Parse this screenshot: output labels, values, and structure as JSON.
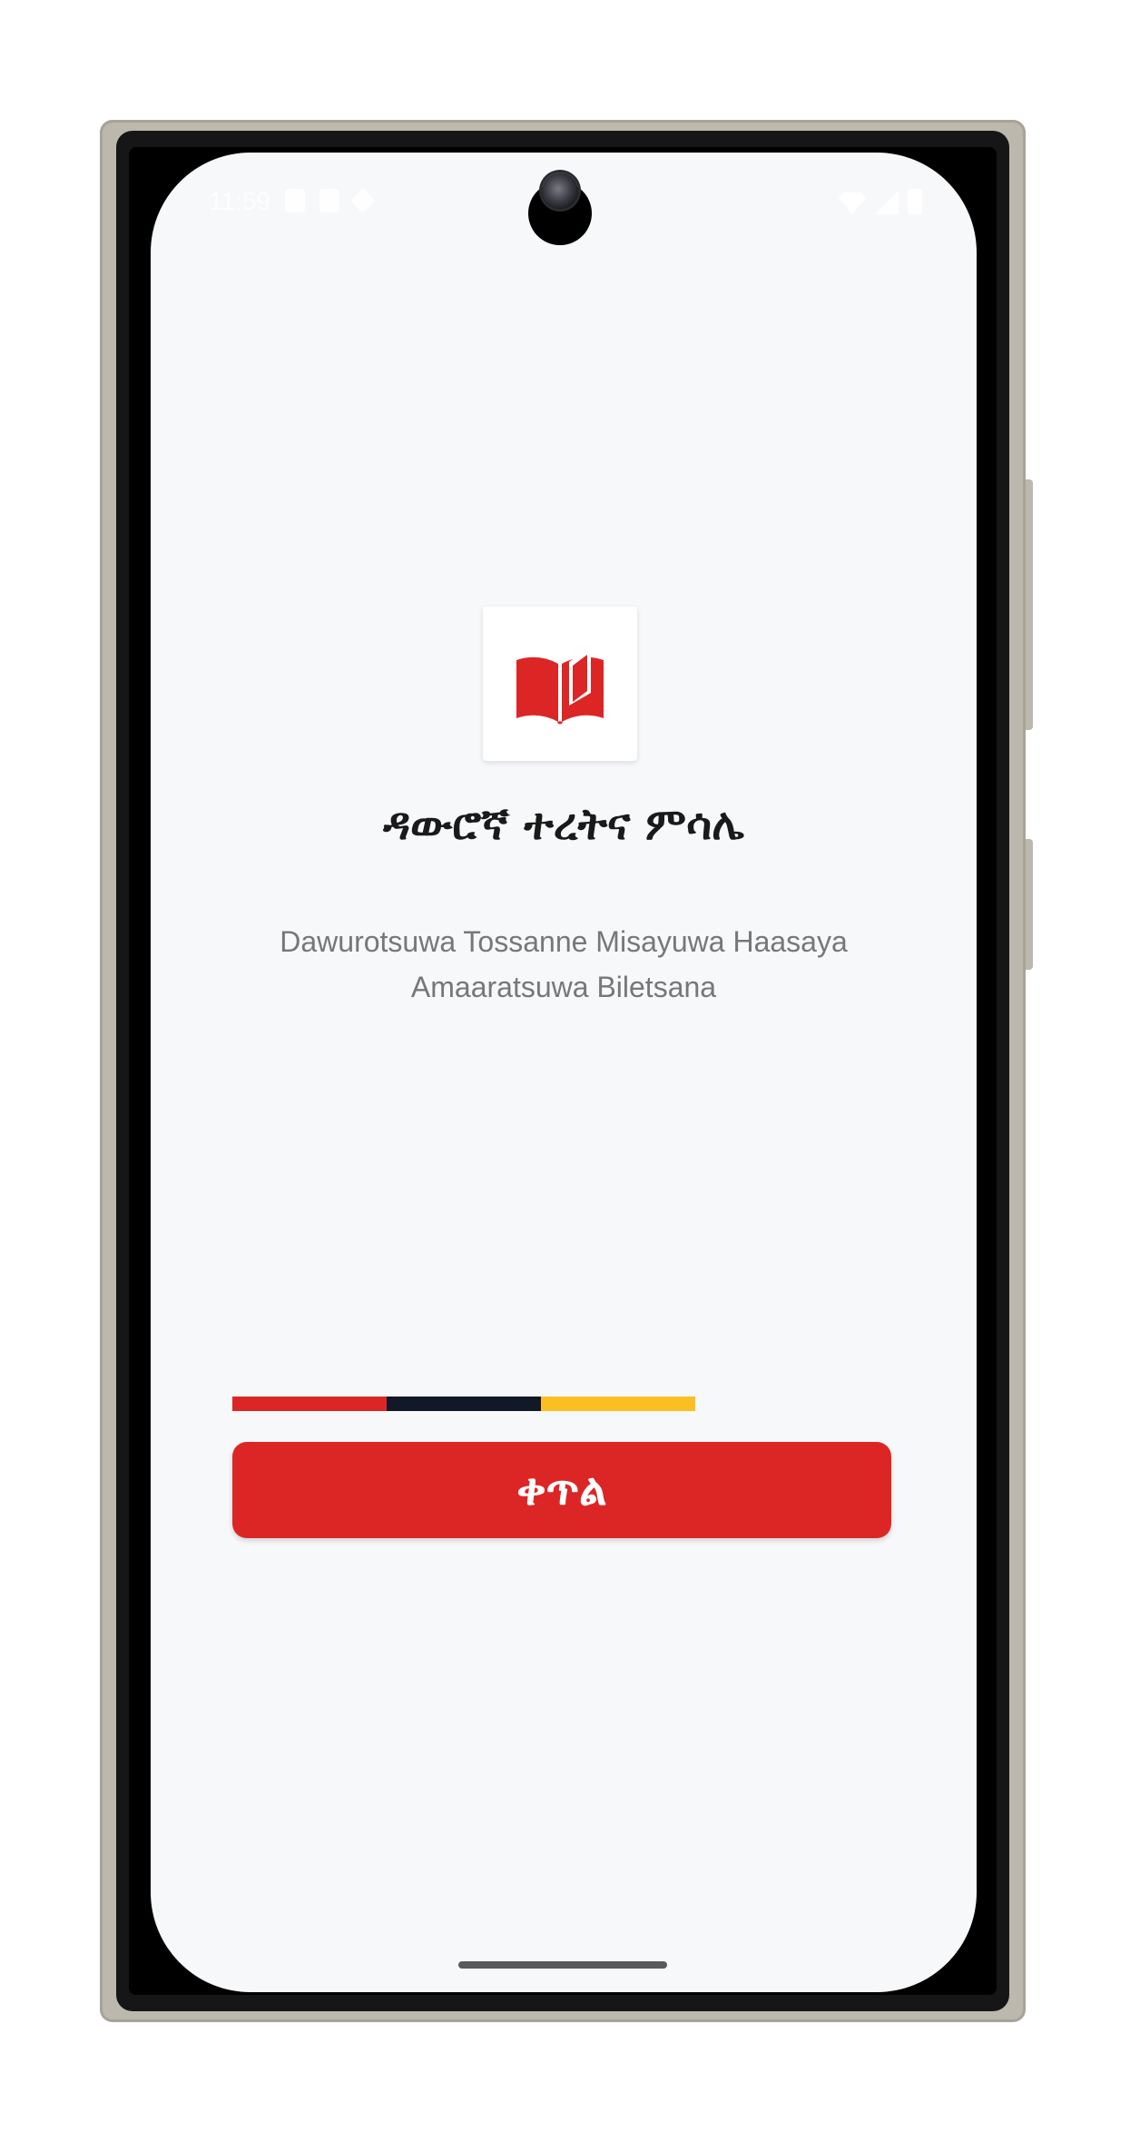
{
  "status_bar": {
    "time": "11:59",
    "icons": [
      "shield-icon",
      "sim-card-icon",
      "data-saver-icon",
      "wifi-icon",
      "signal-icon",
      "battery-icon"
    ]
  },
  "app": {
    "logo_icon": "open-book-icon",
    "title": "ዳውሮኛ ተረትና ምሳሌ",
    "subtitle": "Dawurotsuwa Tossanne Misayuwa Haasaya Amaaratsuwa Biletsana",
    "continue_label": "ቀጥል"
  },
  "colors": {
    "brand_red": "#dc2626",
    "flag_dark": "#111827",
    "flag_yellow": "#fbbf24",
    "background": "#f7f8fa",
    "title_text": "#1a1a1a",
    "subtitle_text": "#777777"
  }
}
